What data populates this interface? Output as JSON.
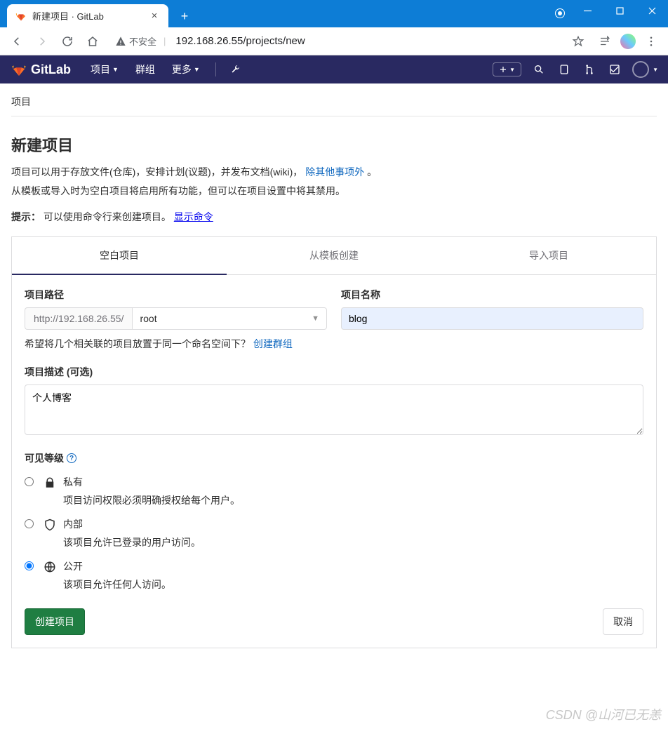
{
  "browser": {
    "tab_title": "新建项目 · GitLab",
    "security_label": "不安全",
    "url": "192.168.26.55/projects/new"
  },
  "nav": {
    "brand": "GitLab",
    "items": [
      "项目",
      "群组",
      "更多"
    ]
  },
  "breadcrumb": "项目",
  "page": {
    "title": "新建项目",
    "intro1_a": "项目可以用于存放文件(仓库)，安排计划(议题)，并发布文档(wiki)，",
    "intro1_link": "除其他事项外",
    "intro1_b": "。",
    "intro2": "从模板或导入时为空白项目将启用所有功能，但可以在项目设置中将其禁用。",
    "tip_label": "提示：",
    "tip_text": "可以使用命令行来创建项目。",
    "tip_link": "显示命令"
  },
  "tabs": [
    "空白项目",
    "从模板创建",
    "导入项目"
  ],
  "form": {
    "path_label": "项目路径",
    "path_prefix": "http://192.168.26.55/",
    "namespace": "root",
    "name_label": "项目名称",
    "name_value": "blog",
    "group_hint": "希望将几个相关联的项目放置于同一个命名空间下？",
    "group_link": "创建群组",
    "desc_label": "项目描述 (可选)",
    "desc_value": "个人博客",
    "visibility_label": "可见等级",
    "vis": [
      {
        "title": "私有",
        "desc": "项目访问权限必须明确授权给每个用户。",
        "checked": false
      },
      {
        "title": "内部",
        "desc": "该项目允许已登录的用户访问。",
        "checked": false
      },
      {
        "title": "公开",
        "desc": "该项目允许任何人访问。",
        "checked": true
      }
    ],
    "submit": "创建项目",
    "cancel": "取消"
  },
  "watermark": "CSDN @山河已无恙"
}
